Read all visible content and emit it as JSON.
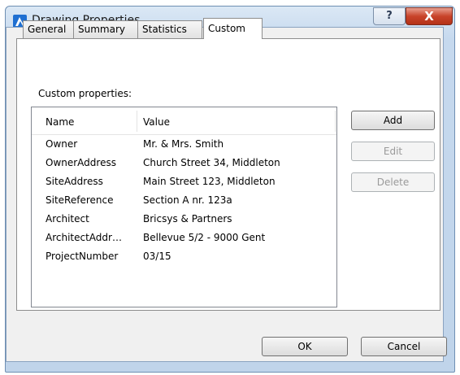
{
  "window": {
    "title": "Drawing Properties"
  },
  "title_buttons": {
    "help": "?",
    "close": "X"
  },
  "tabs": [
    {
      "label": "General",
      "active": false
    },
    {
      "label": "Summary",
      "active": false
    },
    {
      "label": "Statistics",
      "active": false
    },
    {
      "label": "Custom",
      "active": true
    }
  ],
  "custom": {
    "section_label": "Custom properties:",
    "columns": {
      "name": "Name",
      "value": "Value"
    },
    "rows": [
      {
        "name": "Owner",
        "value": "Mr. & Mrs. Smith"
      },
      {
        "name": "OwnerAddress",
        "value": "Church Street 34, Middleton"
      },
      {
        "name": "SiteAddress",
        "value": "Main Street 123, Middleton"
      },
      {
        "name": "SiteReference",
        "value": "Section A nr. 123a"
      },
      {
        "name": "Architect",
        "value": "Bricsys & Partners"
      },
      {
        "name": "ArchitectAddr…",
        "value": "Bellevue 5/2 - 9000 Gent"
      },
      {
        "name": "ProjectNumber",
        "value": "03/15"
      }
    ],
    "buttons": {
      "add": "Add",
      "edit": "Edit",
      "delete": "Delete"
    }
  },
  "footer": {
    "ok": "OK",
    "cancel": "Cancel"
  },
  "colors": {
    "title_bar": "#c6d9ee",
    "close_button": "#c8432a",
    "app_icon": "#1f6fd1"
  }
}
